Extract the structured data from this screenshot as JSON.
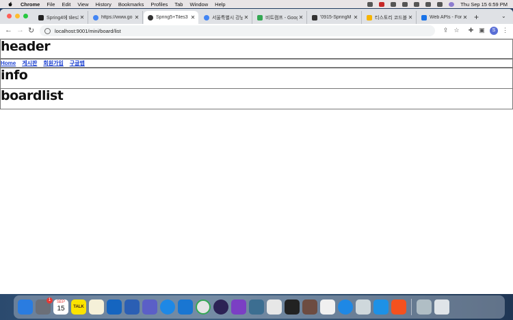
{
  "menubar": {
    "app": "Chrome",
    "items": [
      "File",
      "Edit",
      "View",
      "History",
      "Bookmarks",
      "Profiles",
      "Tab",
      "Window",
      "Help"
    ],
    "clock": "Thu Sep 15  6:59 PM"
  },
  "tabs": [
    {
      "title": "Spring4에 tiles3",
      "fav_color": "#222"
    },
    {
      "title": "https://www.go",
      "fav_color": "#4285f4"
    },
    {
      "title": "Spring5+Tiles3",
      "fav_color": "#333"
    },
    {
      "title": "서울특별시 강남구",
      "fav_color": "#4285f4"
    },
    {
      "title": "비트캠프 - Goog",
      "fav_color": "#34a853"
    },
    {
      "title": "'0915-SpringM",
      "fav_color": "#333"
    },
    {
      "title": "티스토리 코드블",
      "fav_color": "#f6b400"
    },
    {
      "title": "Web APIs - For",
      "fav_color": "#1a73e8"
    }
  ],
  "url": "localhost:9001/mini/board/list",
  "profile_initial": "S",
  "page": {
    "header": "header",
    "menu": [
      "Home",
      "게시판",
      "회원가입",
      "구글맵"
    ],
    "info": "info",
    "boardlist": "boardlist"
  },
  "dock": {
    "calendar_month": "SEP",
    "calendar_day": "15",
    "badge": "1",
    "kakao_label": "TALK"
  }
}
